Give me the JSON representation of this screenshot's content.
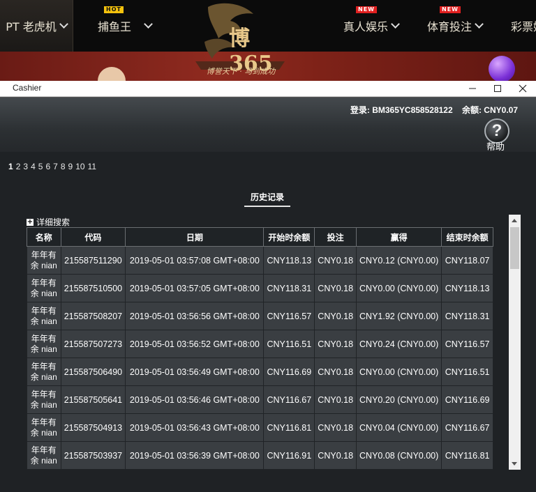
{
  "nav": {
    "items": [
      {
        "label": "PT 老虎机",
        "badge": ""
      },
      {
        "label": "捕鱼王",
        "badge": "HOT"
      },
      {
        "label": "真人娱乐",
        "badge": "NEW"
      },
      {
        "label": "体育投注",
        "badge": "NEW"
      },
      {
        "label": "彩票娱",
        "badge": ""
      }
    ]
  },
  "logo": {
    "text": "博365",
    "slogan": "博誉天下 · 马到成功"
  },
  "window": {
    "title": "Cashier"
  },
  "header": {
    "account": "登录: BM365YC858528122    余额: CNY0.07",
    "help_label": "帮助",
    "help_symbol": "?"
  },
  "pager": {
    "pages": [
      "1",
      "2",
      "3",
      "4",
      "5",
      "6",
      "7",
      "8",
      "9",
      "10",
      "11"
    ],
    "current": "1"
  },
  "tabs": {
    "history": "历史记录"
  },
  "advanced_search": {
    "plus": "+",
    "label": "详细搜索"
  },
  "table": {
    "columns": [
      "名称",
      "代码",
      "日期",
      "开始时余额",
      "投注",
      "赢得",
      "结束时余额"
    ],
    "rows": [
      {
        "name": "年年有余 nian",
        "code": "215587511290",
        "date": "2019-05-01 03:57:08 GMT+08:00",
        "start": "CNY118.13",
        "bet": "CNY0.18",
        "win": "CNY0.12 (CNY0.00)",
        "end": "CNY118.07"
      },
      {
        "name": "年年有余 nian",
        "code": "215587510500",
        "date": "2019-05-01 03:57:05 GMT+08:00",
        "start": "CNY118.31",
        "bet": "CNY0.18",
        "win": "CNY0.00 (CNY0.00)",
        "end": "CNY118.13"
      },
      {
        "name": "年年有余 nian",
        "code": "215587508207",
        "date": "2019-05-01 03:56:56 GMT+08:00",
        "start": "CNY116.57",
        "bet": "CNY0.18",
        "win": "CNY1.92 (CNY0.00)",
        "end": "CNY118.31"
      },
      {
        "name": "年年有余 nian",
        "code": "215587507273",
        "date": "2019-05-01 03:56:52 GMT+08:00",
        "start": "CNY116.51",
        "bet": "CNY0.18",
        "win": "CNY0.24 (CNY0.00)",
        "end": "CNY116.57"
      },
      {
        "name": "年年有余 nian",
        "code": "215587506490",
        "date": "2019-05-01 03:56:49 GMT+08:00",
        "start": "CNY116.69",
        "bet": "CNY0.18",
        "win": "CNY0.00 (CNY0.00)",
        "end": "CNY116.51"
      },
      {
        "name": "年年有余 nian",
        "code": "215587505641",
        "date": "2019-05-01 03:56:46 GMT+08:00",
        "start": "CNY116.67",
        "bet": "CNY0.18",
        "win": "CNY0.20 (CNY0.00)",
        "end": "CNY116.69"
      },
      {
        "name": "年年有余 nian",
        "code": "215587504913",
        "date": "2019-05-01 03:56:43 GMT+08:00",
        "start": "CNY116.81",
        "bet": "CNY0.18",
        "win": "CNY0.04 (CNY0.00)",
        "end": "CNY116.67"
      },
      {
        "name": "年年有余 nian",
        "code": "215587503937",
        "date": "2019-05-01 03:56:39 GMT+08:00",
        "start": "CNY116.91",
        "bet": "CNY0.18",
        "win": "CNY0.08 (CNY0.00)",
        "end": "CNY116.81"
      }
    ]
  },
  "colors": {
    "accent_gold": "#c9a65a",
    "badge_hot": "#f4c20d",
    "badge_new": "#e02020"
  }
}
